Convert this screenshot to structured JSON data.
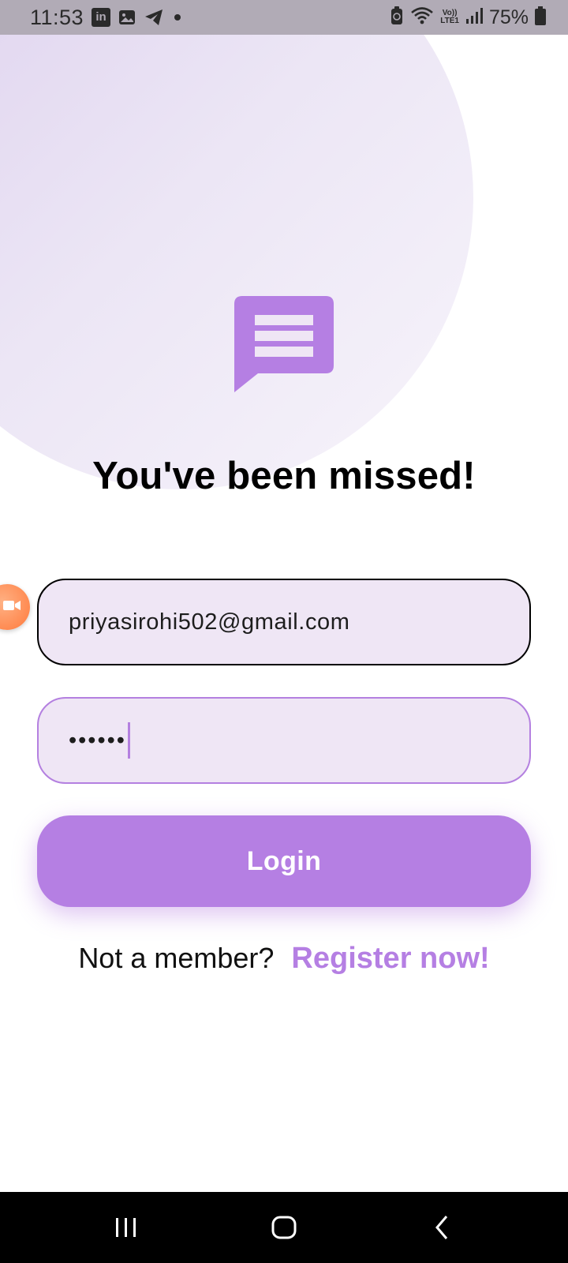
{
  "status_bar": {
    "time": "11:53",
    "linkedin_glyph": "in",
    "battery_percent": "75%",
    "volte_line1": "Vo))",
    "volte_line2": "LTE1",
    "icons": [
      "linkedin-icon",
      "gallery-icon",
      "telegram-icon",
      "notification-dot",
      "recycle-icon",
      "wifi-icon",
      "signal-icon",
      "battery-icon"
    ]
  },
  "login": {
    "headline": "You've been missed!",
    "email_value": "priyasirohi502@gmail.com",
    "password_masked": "••••••",
    "login_label": "Login",
    "register_prompt": "Not a member?",
    "register_link": "Register now!"
  },
  "colors": {
    "accent": "#b57fe3",
    "field_bg": "#efe6f5",
    "status_bar_bg": "#b1abb6",
    "circle_bg": "#e6ddf1"
  },
  "nav": {
    "buttons": [
      "recent-apps-icon",
      "home-icon",
      "back-icon"
    ]
  }
}
